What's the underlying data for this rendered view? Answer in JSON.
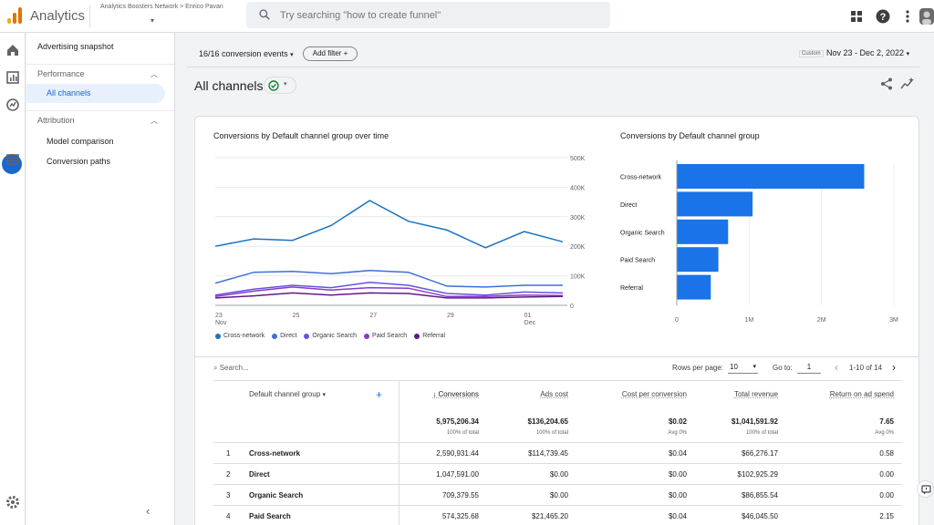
{
  "app": {
    "name": "Analytics",
    "account_path": "Analytics Boosters Network > Enrico Pavan"
  },
  "search": {
    "placeholder": "Try searching \"how to create funnel\""
  },
  "sidenav": {
    "top_item": "Advertising snapshot",
    "sections": [
      {
        "label": "Performance",
        "items": [
          "All channels"
        ]
      },
      {
        "label": "Attribution",
        "items": [
          "Model comparison",
          "Conversion paths"
        ]
      }
    ]
  },
  "filters": {
    "conversion_events": "16/16 conversion events",
    "add_filter": "Add filter"
  },
  "date": {
    "badge": "Custom",
    "range": "Nov 23 - Dec 2, 2022"
  },
  "page": {
    "title": "All channels"
  },
  "charts": {
    "line_title": "Conversions by Default channel group over time",
    "bar_title": "Conversions by Default channel group"
  },
  "chart_data": [
    {
      "type": "line",
      "title": "Conversions by Default channel group over time",
      "x": [
        "Nov 23",
        "Nov 24",
        "Nov 25",
        "Nov 26",
        "Nov 27",
        "Nov 28",
        "Nov 29",
        "Nov 30",
        "Dec 1",
        "Dec 2"
      ],
      "x_tick_labels": [
        {
          "day": "23",
          "month": "Nov"
        },
        {
          "day": "25",
          "month": ""
        },
        {
          "day": "27",
          "month": ""
        },
        {
          "day": "29",
          "month": ""
        },
        {
          "day": "01",
          "month": "Dec"
        }
      ],
      "y_tick_labels": [
        "500K",
        "400K",
        "300K",
        "200K",
        "100K",
        "0"
      ],
      "ylim": [
        0,
        500000
      ],
      "series": [
        {
          "name": "Cross-network",
          "color": "#1a73c4",
          "values": [
            200000,
            225000,
            220000,
            270000,
            355000,
            285000,
            255000,
            195000,
            250000,
            215000
          ]
        },
        {
          "name": "Direct",
          "color": "#3d6fd8",
          "values": [
            75000,
            112000,
            115000,
            107000,
            118000,
            112000,
            65000,
            62000,
            68000,
            68000
          ]
        },
        {
          "name": "Organic Search",
          "color": "#6554e0",
          "values": [
            35000,
            55000,
            68000,
            60000,
            78000,
            68000,
            40000,
            35000,
            45000,
            42000
          ]
        },
        {
          "name": "Paid Search",
          "color": "#8a3ac8",
          "values": [
            30000,
            48000,
            62000,
            52000,
            60000,
            58000,
            30000,
            30000,
            35000,
            33000
          ]
        },
        {
          "name": "Referral",
          "color": "#5e1a8a",
          "values": [
            25000,
            32000,
            42000,
            35000,
            42000,
            40000,
            25000,
            25000,
            28000,
            30000
          ]
        }
      ]
    },
    {
      "type": "bar",
      "title": "Conversions by Default channel group",
      "orientation": "horizontal",
      "categories": [
        "Cross-network",
        "Direct",
        "Organic Search",
        "Paid Search",
        "Referral"
      ],
      "values": [
        2590931.44,
        1047591.0,
        709379.55,
        574325.68,
        470000
      ],
      "x_tick_labels": [
        "0",
        "1M",
        "2M",
        "3M"
      ],
      "xlim": [
        0,
        3000000
      ],
      "color": "#1a73e8"
    }
  ],
  "table": {
    "search_placeholder": "Search...",
    "rows_per_page_label": "Rows per page:",
    "rows_per_page": "10",
    "goto_label": "Go to:",
    "goto_value": "1",
    "range": "1-10 of 14",
    "dimension_header": "Default channel group",
    "columns": [
      "Conversions",
      "Ads cost",
      "Cost per conversion",
      "Total revenue",
      "Return on ad spend"
    ],
    "totals": [
      "5,975,206.34",
      "$136,204.65",
      "$0.02",
      "$1,041,591.92",
      "7.65"
    ],
    "totals_sub": [
      "100% of total",
      "100% of total",
      "Avg 0%",
      "100% of total",
      "Avg 0%"
    ],
    "rows": [
      {
        "idx": "1",
        "name": "Cross-network",
        "values": [
          "2,590,931.44",
          "$114,739.45",
          "$0.04",
          "$66,276.17",
          "0.58"
        ]
      },
      {
        "idx": "2",
        "name": "Direct",
        "values": [
          "1,047,591.00",
          "$0.00",
          "$0.00",
          "$102,925.29",
          "0.00"
        ]
      },
      {
        "idx": "3",
        "name": "Organic Search",
        "values": [
          "709,379.55",
          "$0.00",
          "$0.00",
          "$86,855.54",
          "0.00"
        ]
      },
      {
        "idx": "4",
        "name": "Paid Search",
        "values": [
          "574,325.68",
          "$21,465.20",
          "$0.04",
          "$46,045.50",
          "2.15"
        ]
      }
    ]
  }
}
